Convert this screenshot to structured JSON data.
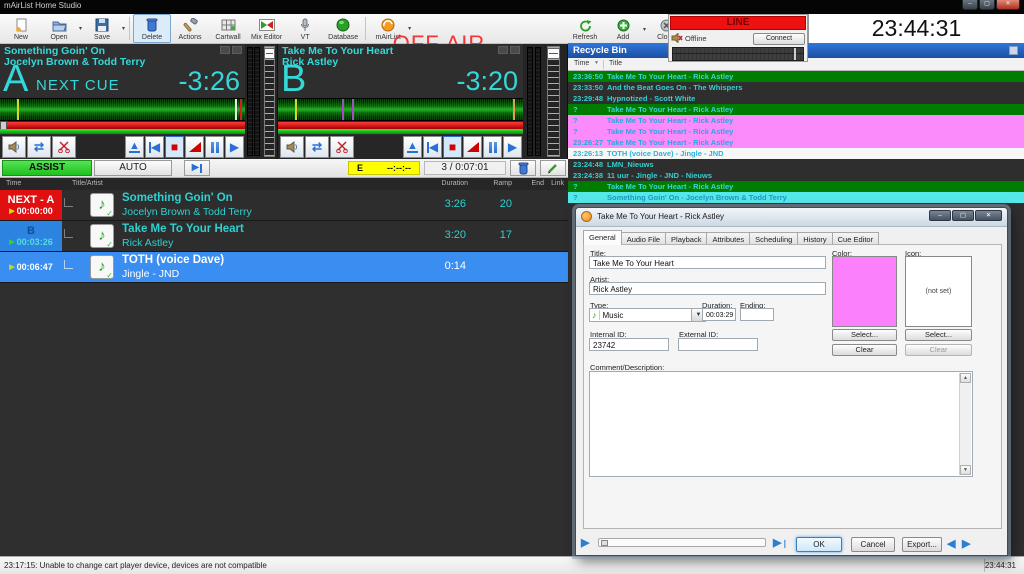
{
  "window": {
    "title": "mAirList Home Studio",
    "off_air": "OFF AIR",
    "clock": "23:44:31"
  },
  "toolbar": {
    "items": [
      "New",
      "Open",
      "Save",
      "Delete",
      "Actions",
      "Cartwall",
      "Mix Editor",
      "VT",
      "Database",
      "mAirList"
    ],
    "right_items": [
      "Refresh",
      "Add",
      "Close"
    ]
  },
  "encoder": {
    "line": "LINE",
    "status": "Offline",
    "connect": "Connect"
  },
  "players": [
    {
      "id": "A",
      "title": "Something Goin' On",
      "artist": "Jocelyn Brown & Todd Terry",
      "cue_label": "NEXT CUE",
      "remaining": "-3:26"
    },
    {
      "id": "B",
      "title": "Take Me To Your Heart",
      "artist": "Rick Astley",
      "cue_label": "",
      "remaining": "-3:20"
    }
  ],
  "transport": {
    "assist": "ASSIST",
    "auto": "AUTO",
    "countdown_prefix": "E",
    "countdown_value": "--:--:--",
    "position": "3 / 0:07:01"
  },
  "playlist": {
    "columns": {
      "time": "Time",
      "title": "Title/Artist",
      "duration": "Duration",
      "ramp": "Ramp",
      "end": "End",
      "link": "Link"
    },
    "rows": [
      {
        "badge": "NEXT - A",
        "time": "00:00:00",
        "title": "Something Goin' On",
        "artist": "Jocelyn Brown & Todd Terry",
        "duration": "3:26",
        "ramp": "20"
      },
      {
        "badge": "B",
        "time": "00:03:26",
        "title": "Take Me To Your Heart",
        "artist": "Rick Astley",
        "duration": "3:20",
        "ramp": "17"
      },
      {
        "badge": "",
        "time": "00:06:47",
        "title": "TOTH (voice Dave)",
        "artist": "Jingle - JND",
        "duration": "0:14",
        "ramp": ""
      }
    ]
  },
  "recycle": {
    "title": "Recycle Bin",
    "columns": {
      "time": "Time",
      "title": "Title"
    },
    "rows": [
      {
        "time": "23:36:50",
        "title": "Take Me To Your Heart - Rick Astley",
        "color": "green"
      },
      {
        "time": "23:33:50",
        "title": "And the Beat Goes On - The Whispers",
        "color": "dark"
      },
      {
        "time": "23:29:48",
        "title": "Hypnotized - Scott White",
        "color": "dark"
      },
      {
        "time": "?",
        "title": "Take Me To Your Heart - Rick Astley",
        "color": "green"
      },
      {
        "time": "?",
        "title": "Take Me To Your Heart - Rick Astley",
        "color": "pink"
      },
      {
        "time": "?",
        "title": "Take Me To Your Heart - Rick Astley",
        "color": "pink"
      },
      {
        "time": "23:26:27",
        "title": "Take Me To Your Heart - Rick Astley",
        "color": "pink"
      },
      {
        "time": "23:26:13",
        "title": "TOTH (voice Dave) - Jingle - JND",
        "color": "white"
      },
      {
        "time": "23:24:48",
        "title": "LMN_Nieuws",
        "color": "dark"
      },
      {
        "time": "23:24:38",
        "title": "11 uur - Jingle - JND - Nieuws",
        "color": "dark"
      },
      {
        "time": "?",
        "title": "Take Me To Your Heart - Rick Astley",
        "color": "green"
      },
      {
        "time": "?",
        "title": "Something Goin' On - Jocelyn Brown & Todd Terry",
        "color": "cyan"
      }
    ]
  },
  "dialog": {
    "title": "Take Me To Your Heart - Rick Astley",
    "tabs": [
      "General",
      "Audio File",
      "Playback",
      "Attributes",
      "Scheduling",
      "History",
      "Cue Editor"
    ],
    "labels": {
      "title": "Title:",
      "artist": "Artist:",
      "type": "Type:",
      "duration": "Duration:",
      "ending": "Ending:",
      "internal_id": "Internal ID:",
      "external_id": "External ID:",
      "comment": "Comment/Description:",
      "color": "Color:",
      "icon": "Icon:"
    },
    "values": {
      "title": "Take Me To Your Heart",
      "artist": "Rick Astley",
      "type": "Music",
      "duration": "00:03:29",
      "ending": "",
      "internal_id": "23742",
      "external_id": "",
      "comment": "",
      "icon_placeholder": "(not set)"
    },
    "color_swatch": "#fb80fb",
    "buttons": {
      "select_color": "Select...",
      "clear_color": "Clear",
      "select_icon": "Select...",
      "clear_icon": "Clear",
      "ok": "OK",
      "cancel": "Cancel",
      "export": "Export..."
    }
  },
  "statusbar": {
    "message": "23:17:15: Unable to change cart player device, devices are not compatible",
    "time": "23:44:31"
  },
  "colors": {
    "accent_cyan": "#35d8d8",
    "next_red": "#e01010",
    "player_b_blue": "#2d84e0",
    "selected_blue": "#3a8ef2",
    "row_green": "#007c00",
    "row_pink": "#fb8afb",
    "row_cyan": "#55e8e8",
    "line_red": "#ee1111",
    "assist_green": "#35e135",
    "countdown_yellow": "#ffff00"
  }
}
